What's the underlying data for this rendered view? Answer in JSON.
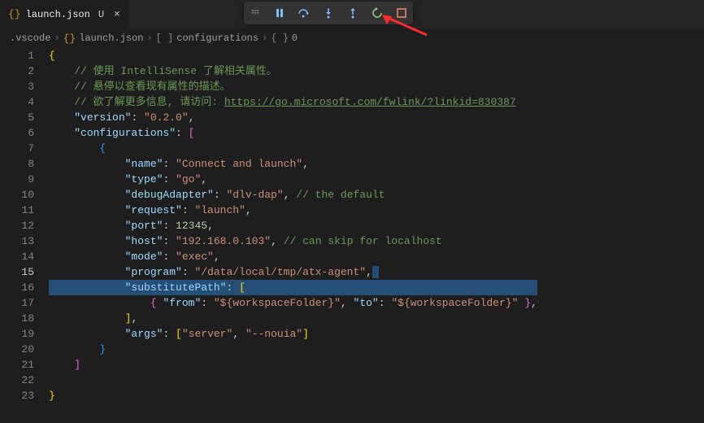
{
  "tab": {
    "icon_label": "{}",
    "filename": "launch.json",
    "modified_marker": "U",
    "close_glyph": "×"
  },
  "debug_toolbar": {
    "pause": "pause",
    "step_over": "step-over",
    "step_into": "step-into",
    "step_out": "step-out",
    "restart": "restart",
    "stop": "stop"
  },
  "breadcrumbs": {
    "folder": ".vscode",
    "file_icon": "{}",
    "file": "launch.json",
    "seg1_icon": "[ ]",
    "seg1": "configurations",
    "seg2_icon": "{ }",
    "seg2": "0"
  },
  "code": {
    "c1": "// 使用 IntelliSense 了解相关属性。",
    "c2": "// 悬停以查看现有属性的描述。",
    "c3_prefix": "// 欲了解更多信息, 请访问: ",
    "c3_link": "https://go.microsoft.com/fwlink/?linkid=830387",
    "version_key": "\"version\"",
    "version_val": "\"0.2.0\"",
    "config_key": "\"configurations\"",
    "name_key": "\"name\"",
    "name_val": "\"Connect and launch\"",
    "type_key": "\"type\"",
    "type_val": "\"go\"",
    "da_key": "\"debugAdapter\"",
    "da_val": "\"dlv-dap\"",
    "da_comment": "// the default",
    "request_key": "\"request\"",
    "request_val": "\"launch\"",
    "port_key": "\"port\"",
    "port_val": "12345",
    "host_key": "\"host\"",
    "host_val": "\"192.168.0.103\"",
    "host_comment": "// can skip for localhost",
    "mode_key": "\"mode\"",
    "mode_val": "\"exec\"",
    "program_key": "\"program\"",
    "program_val": "\"/data/local/tmp/atx-agent\"",
    "sub_key": "\"substitutePath\"",
    "from_key": "\"from\"",
    "from_val": "\"${workspaceFolder}\"",
    "to_key": "\"to\"",
    "to_val": "\"${workspaceFolder}\"",
    "args_key": "\"args\"",
    "args_v1": "\"server\"",
    "args_v2": "\"--nouia\""
  },
  "line_numbers": [
    "1",
    "2",
    "3",
    "4",
    "5",
    "6",
    "7",
    "8",
    "9",
    "10",
    "11",
    "12",
    "13",
    "14",
    "15",
    "16",
    "17",
    "18",
    "19",
    "20",
    "21",
    "22",
    "23"
  ],
  "active_line": 15,
  "selected_line": 16
}
